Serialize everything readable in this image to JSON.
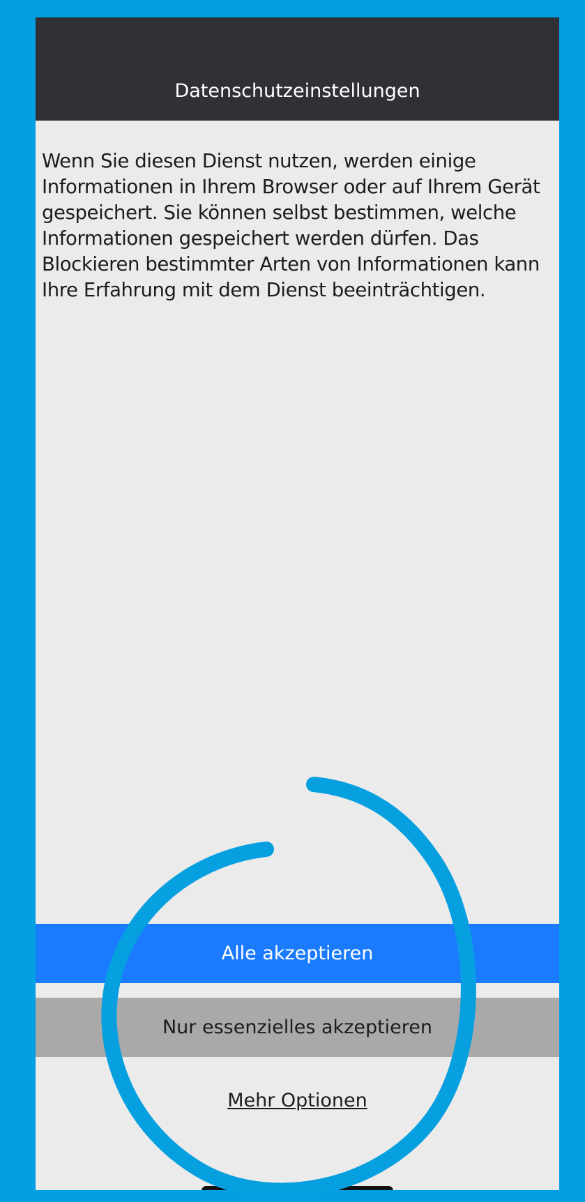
{
  "header": {
    "title": "Datenschutzeinstellungen"
  },
  "main": {
    "body_text": "Wenn Sie diesen Dienst nutzen, werden einige Informationen in Ihrem Browser oder auf Ihrem Gerät gespeichert. Sie können selbst bestimmen, welche Informationen gespeichert werden dürfen. Das Blockieren bestimmter Arten von Informationen kann Ihre Erfahrung mit dem Dienst beeinträchtigen."
  },
  "actions": {
    "accept_all_label": "Alle akzeptieren",
    "accept_essential_label": "Nur essenzielles akzeptieren",
    "more_options_label": "Mehr Optionen"
  },
  "colors": {
    "frame": "#029fe3",
    "header_bg": "#2f3136",
    "accept_all_bg": "#1a7bff",
    "accept_essential_bg": "#a9a9a9",
    "annotation": "#069fe0"
  }
}
